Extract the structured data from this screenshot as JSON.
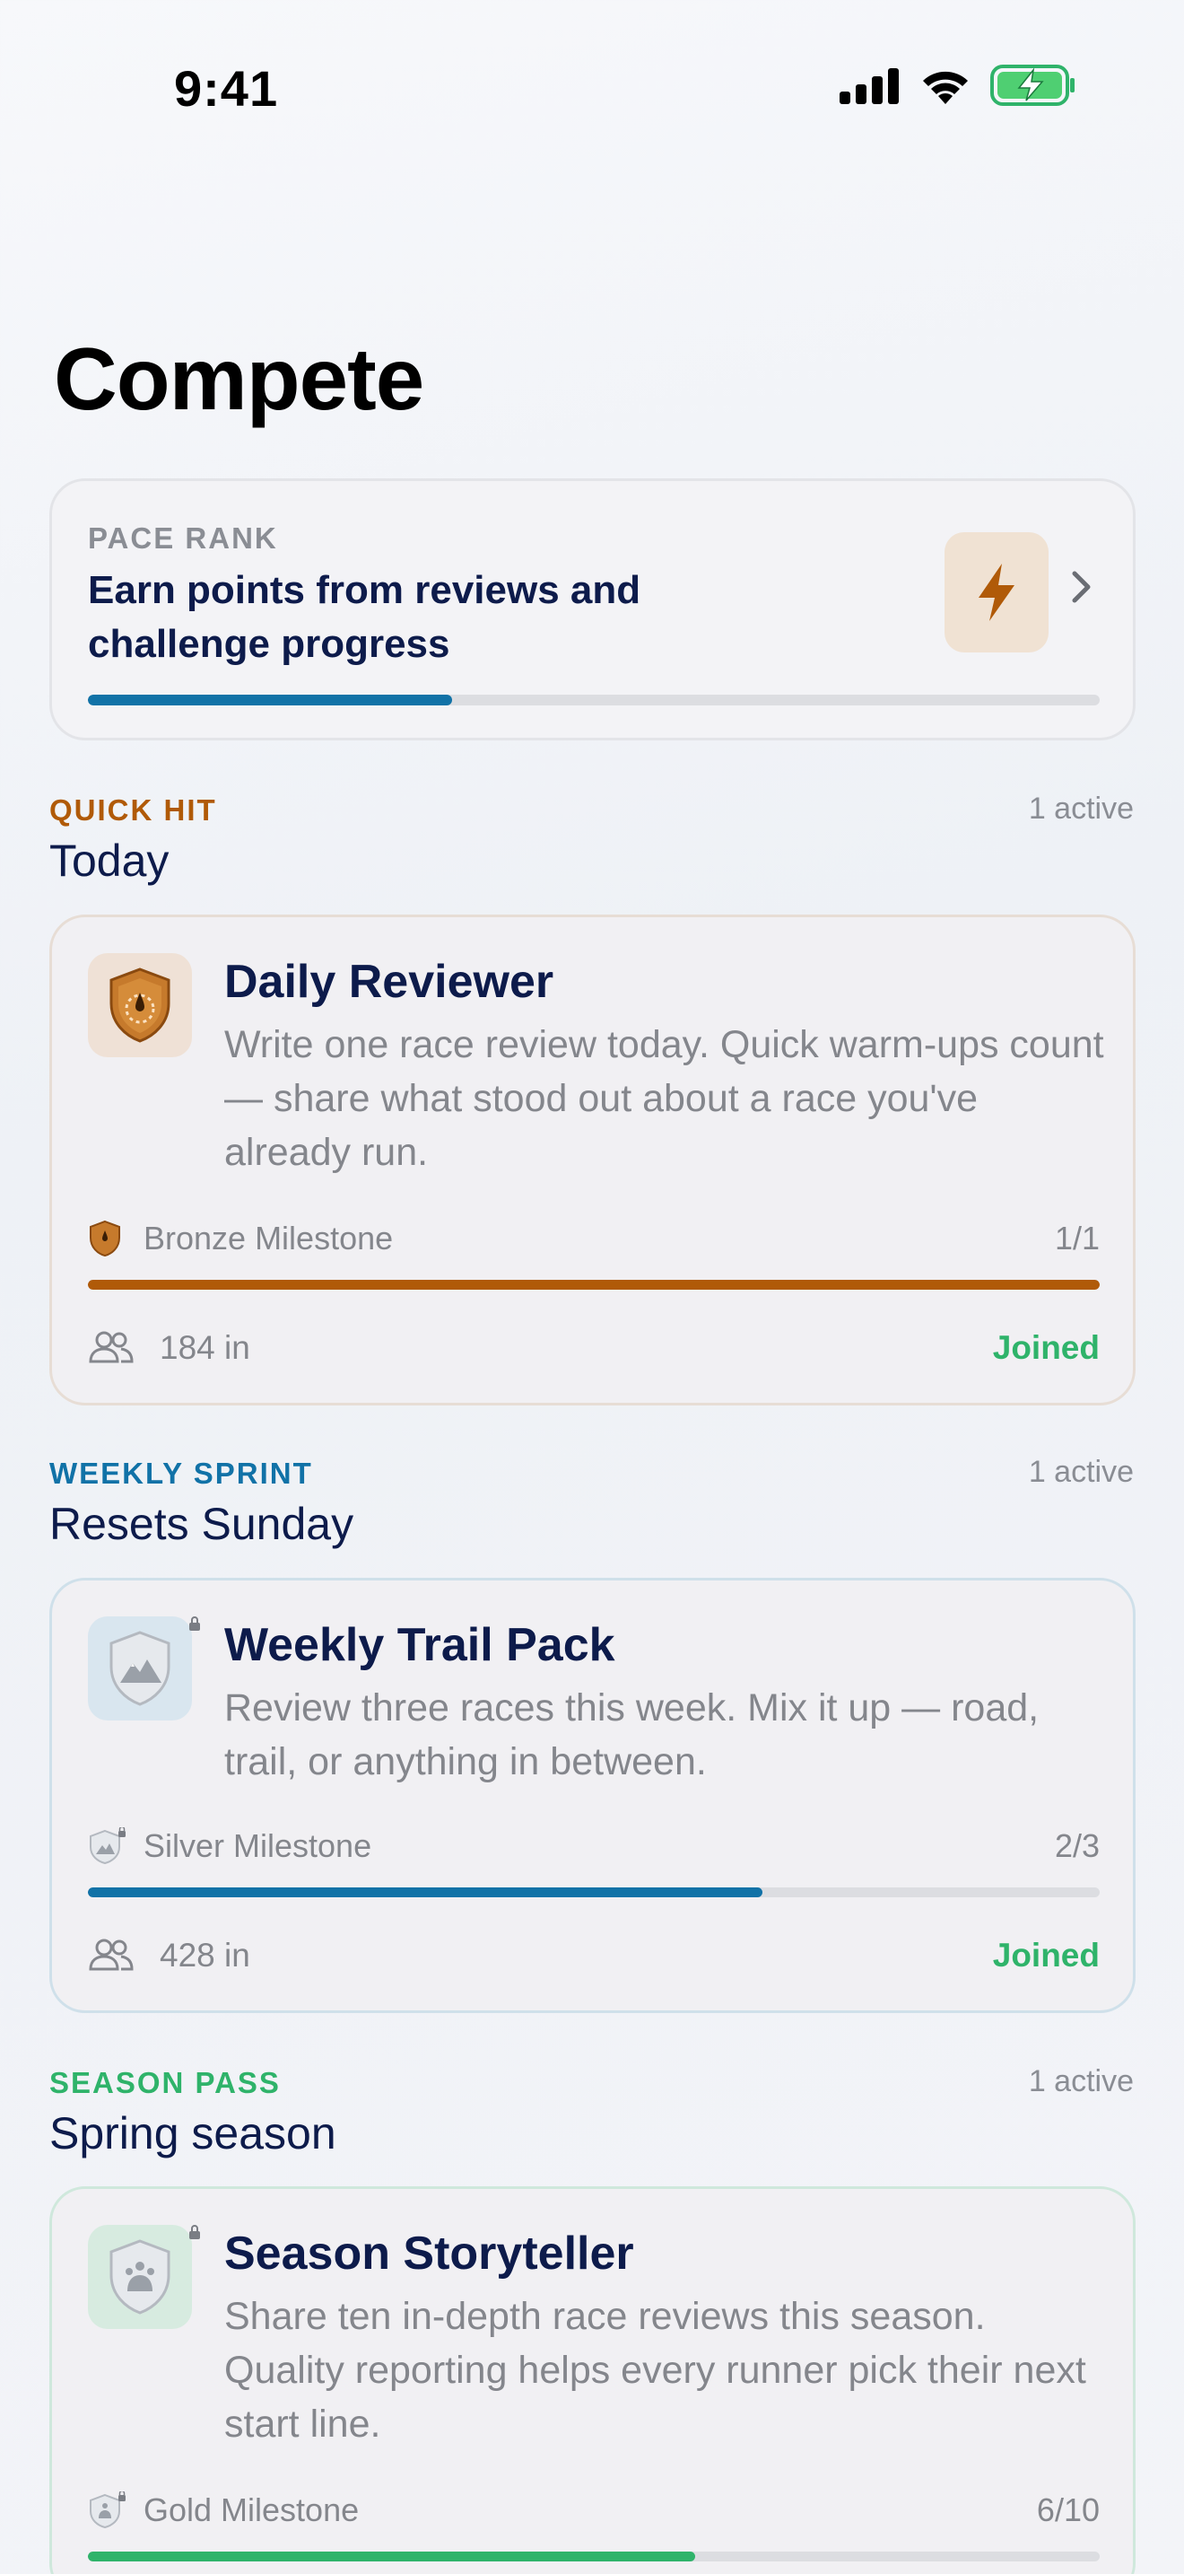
{
  "status_bar": {
    "time": "9:41"
  },
  "page": {
    "title": "Compete"
  },
  "rank": {
    "label": "PACE RANK",
    "text": "Earn points from reviews and challenge progress",
    "progress": 0.36,
    "icon": "lightning-icon",
    "accent": "#1172a7"
  },
  "sections": [
    {
      "kicker": "QUICK HIT",
      "kicker_color": "#b05a08",
      "count": "1 active",
      "title": "Today",
      "card": {
        "title": "Daily Reviewer",
        "description": "Write one race review today. Quick warm-ups count — share what stood out about a race you've already run.",
        "milestone": "Bronze Milestone",
        "progress_text": "1/1",
        "progress": 1.0,
        "bar_color": "#b05a08",
        "participants": "184 in",
        "status": "Joined",
        "badge_icon": "bronze-shield-icon"
      }
    },
    {
      "kicker": "WEEKLY SPRINT",
      "kicker_color": "#1172a7",
      "count": "1 active",
      "title": "Resets Sunday",
      "card": {
        "title": "Weekly Trail Pack",
        "description": "Review three races this week. Mix it up — road, trail, or anything in between.",
        "milestone": "Silver Milestone",
        "progress_text": "2/3",
        "progress": 0.667,
        "bar_color": "#1172a7",
        "participants": "428 in",
        "status": "Joined",
        "badge_icon": "silver-shield-icon"
      }
    },
    {
      "kicker": "SEASON PASS",
      "kicker_color": "#2fb36a",
      "count": "1 active",
      "title": "Spring season",
      "card": {
        "title": "Season Storyteller",
        "description": "Share ten in-depth race reviews this season. Quality reporting helps every runner pick their next start line.",
        "milestone": "Gold Milestone",
        "progress_text": "6/10",
        "progress": 0.6,
        "bar_color": "#2fb36a",
        "badge_icon": "gold-shield-icon"
      }
    }
  ]
}
